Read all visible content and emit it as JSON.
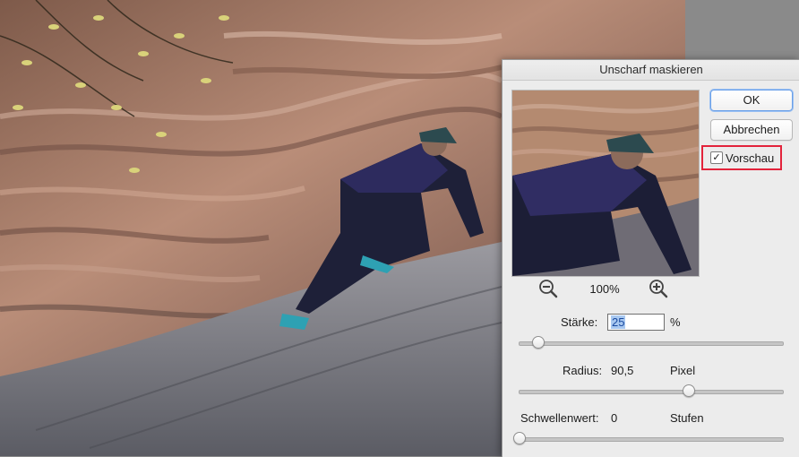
{
  "dialog": {
    "title": "Unscharf maskieren",
    "ok_label": "OK",
    "cancel_label": "Abbrechen",
    "preview_label": "Vorschau",
    "preview_checked": true,
    "zoom_level": "100%",
    "staerke": {
      "label": "Stärke:",
      "value": "25",
      "unit": "%",
      "level": 0.07
    },
    "radius": {
      "label": "Radius:",
      "value": "90,5",
      "unit": "Pixel",
      "level": 0.64
    },
    "schwellenwert": {
      "label": "Schwellenwert:",
      "value": "0",
      "unit": "Stufen",
      "level": 0.0
    }
  },
  "icons": {
    "zoom_out": "zoom-out-icon",
    "zoom_in": "zoom-in-icon",
    "checkmark": "checkmark-icon"
  },
  "colors": {
    "highlight_box": "#e3233b",
    "ok_focus": "#6aa0e8"
  }
}
